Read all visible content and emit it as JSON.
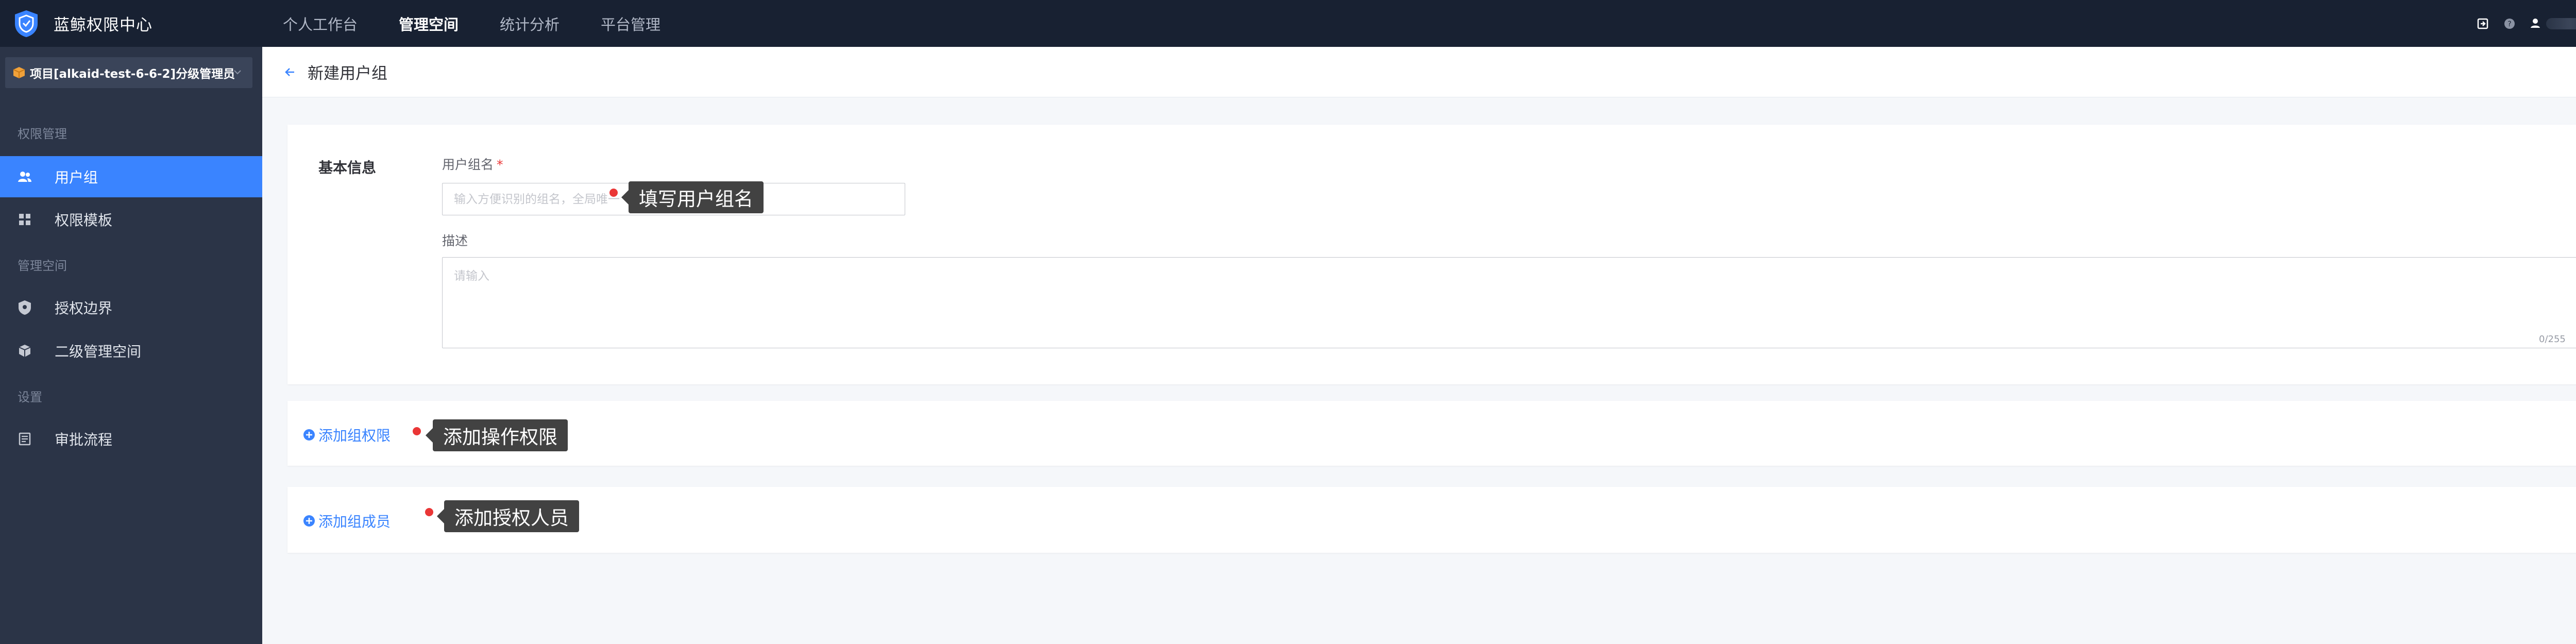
{
  "app": {
    "title": "蓝鲸权限中心",
    "logo_icon": "shield-logo-icon",
    "colors": {
      "header_bg": "#182132",
      "sidebar_bg": "#2b3447",
      "accent": "#3a84ff",
      "tip_bg": "#424242",
      "required": "#ea3636"
    }
  },
  "topnav": {
    "items": [
      {
        "label": "个人工作台",
        "active": false
      },
      {
        "label": "管理空间",
        "active": true
      },
      {
        "label": "统计分析",
        "active": false
      },
      {
        "label": "平台管理",
        "active": false
      }
    ]
  },
  "topright": {
    "icons": [
      "export-icon",
      "help-icon",
      "user-avatar-icon",
      "chevron-down-icon"
    ]
  },
  "sidebar": {
    "project": {
      "label": "项目[alkaid-test-6-6-2]分级管理员",
      "icon": "cube-icon"
    },
    "groups": [
      {
        "title": "权限管理",
        "items": [
          {
            "label": "用户组",
            "icon": "users-icon",
            "active": true
          },
          {
            "label": "权限模板",
            "icon": "grid-icon",
            "active": false
          }
        ]
      },
      {
        "title": "管理空间",
        "items": [
          {
            "label": "授权边界",
            "icon": "shield-icon",
            "active": false
          },
          {
            "label": "二级管理空间",
            "icon": "box-icon",
            "active": false
          }
        ]
      },
      {
        "title": "设置",
        "items": [
          {
            "label": "审批流程",
            "icon": "document-icon",
            "active": false
          }
        ]
      }
    ]
  },
  "page": {
    "title": "新建用户组",
    "basic": {
      "section_label": "基本信息",
      "name_label": "用户组名",
      "required_mark": "*",
      "name_placeholder": "输入方便识别的组名，全局唯一",
      "name_value": "",
      "desc_label": "描述",
      "desc_placeholder": "请输入",
      "desc_counter": "0/255"
    },
    "add_permission": "添加组权限",
    "add_member": "添加组成员"
  },
  "annotations": {
    "name_tip": "填写用户组名",
    "perm_tip": "添加操作权限",
    "member_tip": "添加授权人员"
  }
}
